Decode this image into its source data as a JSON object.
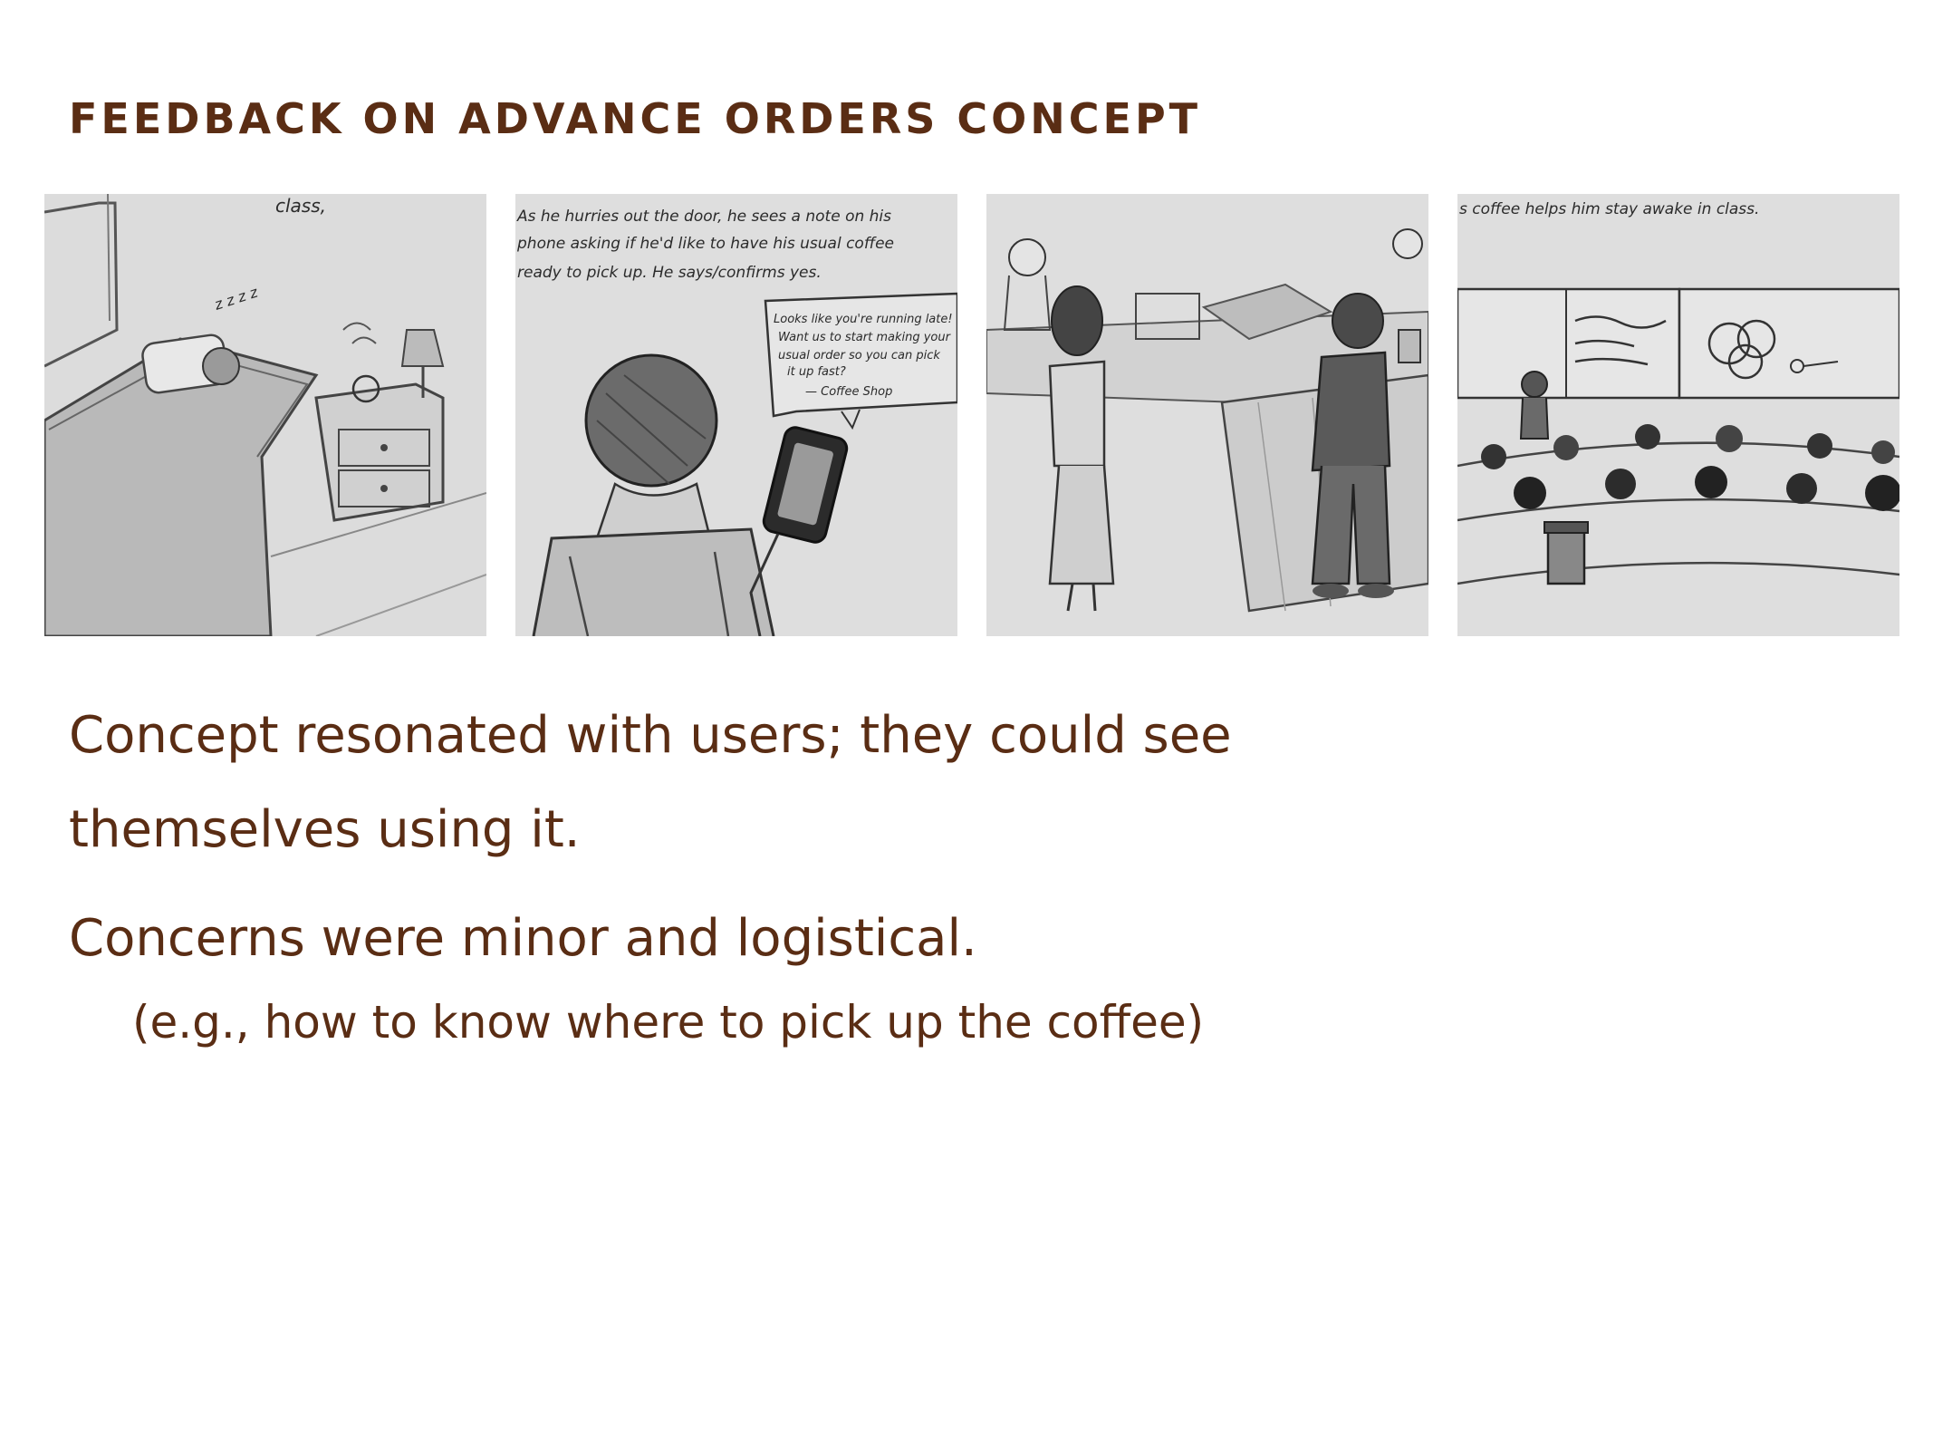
{
  "slide": {
    "title": "FEEDBACK ON ADVANCE ORDERS CONCEPT"
  },
  "storyboard": {
    "panel_1": {
      "caption": "class,",
      "snore": "z z z z"
    },
    "panel_2": {
      "caption_line_1": "As he hurries out the door, he sees a note on his",
      "caption_line_2": "phone asking if he'd like to have his usual coffee",
      "caption_line_3": "ready to pick up. He says/confirms yes.",
      "bubble_line_1": "Looks like you're running late!",
      "bubble_line_2": "Want us to start making your",
      "bubble_line_3": "usual order so you can pick",
      "bubble_line_4": "it up fast?",
      "bubble_line_5": "— Coffee Shop"
    },
    "panel_4": {
      "caption": "s coffee helps him stay awake in class."
    }
  },
  "bullets": [
    {
      "line_1": "Concept resonated with users; they could see",
      "line_2": "themselves using it."
    },
    {
      "text": "Concerns were minor and logistical.",
      "sub": "(e.g., how to know where to pick up the coffee)"
    }
  ]
}
